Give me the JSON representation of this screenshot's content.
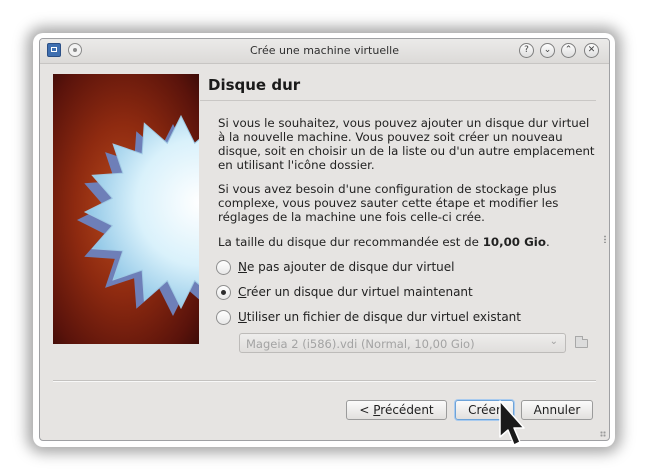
{
  "window": {
    "title": "Crée une machine virtuelle",
    "icons": [
      "virtualbox-app-icon",
      "pin-icon",
      "help-icon",
      "minimize-icon",
      "maximize-icon",
      "close-icon"
    ],
    "help_glyph": "?",
    "min_glyph": "⌄",
    "max_glyph": "⌃",
    "close_glyph": "✕"
  },
  "page": {
    "heading": "Disque dur",
    "para1": "Si vous le souhaitez, vous pouvez ajouter un disque dur virtuel à la nouvelle machine. Vous pouvez soit créer un nouveau disque, soit en choisir un de la liste ou d'un autre emplacement en utilisant l'icône dossier.",
    "para2": "Si vous avez besoin d'une configuration de stockage plus complexe, vous pouvez sauter cette étape et modifier les réglages de la machine une fois celle-ci crée.",
    "recommend_prefix": "La taille du disque dur recommandée est de ",
    "recommend_value": "10,00 Gio",
    "recommend_suffix": "."
  },
  "options": [
    {
      "mnemonic": "N",
      "rest": "e pas ajouter de disque dur virtuel",
      "checked": false
    },
    {
      "mnemonic": "C",
      "rest": "réer un disque dur virtuel maintenant",
      "checked": true
    },
    {
      "mnemonic": "U",
      "rest": "tiliser un fichier de disque dur virtuel existant",
      "checked": false
    }
  ],
  "disk_combo": {
    "value": "Mageia 2 (i586).vdi (Normal, 10,00 Gio)",
    "enabled": false,
    "arrow": "⌄"
  },
  "buttons": {
    "back_prefix": "< ",
    "back_mnemonic": "P",
    "back_rest": "récédent",
    "create": "Créer",
    "cancel": "Annuler"
  },
  "colors": {
    "art_red": "#8e2a10",
    "star_blue": "#bfe6f7",
    "star_shadow": "#6e7fb8",
    "focus": "#6ea3d8"
  }
}
